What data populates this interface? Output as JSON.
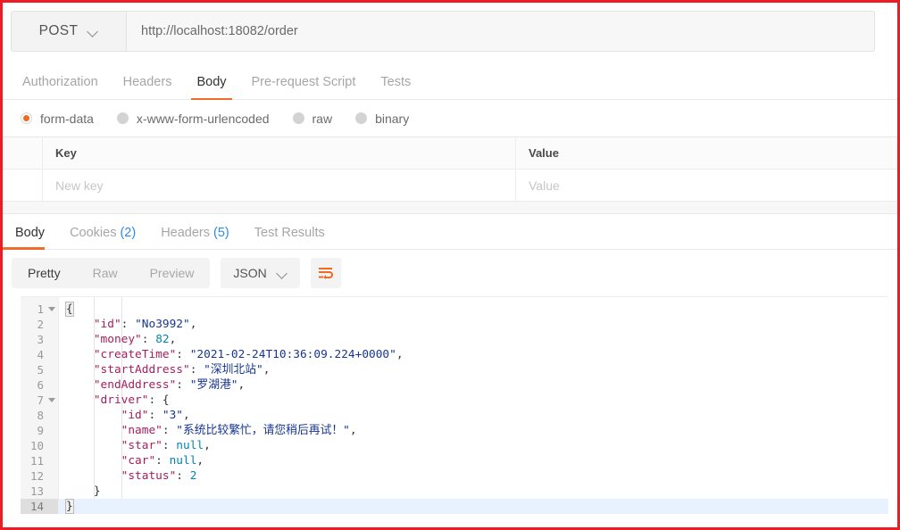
{
  "request": {
    "method": "POST",
    "method_icon": "chevron-down-icon",
    "url": "http://localhost:18082/order",
    "tabs": [
      {
        "label": "Authorization",
        "active": false
      },
      {
        "label": "Headers",
        "active": false
      },
      {
        "label": "Body",
        "active": true
      },
      {
        "label": "Pre-request Script",
        "active": false
      },
      {
        "label": "Tests",
        "active": false
      }
    ],
    "body_types": [
      {
        "label": "form-data",
        "selected": true
      },
      {
        "label": "x-www-form-urlencoded",
        "selected": false
      },
      {
        "label": "raw",
        "selected": false
      },
      {
        "label": "binary",
        "selected": false
      }
    ],
    "table": {
      "headers": [
        "Key",
        "Value"
      ],
      "rows": [
        {
          "key_placeholder": "New key",
          "value_placeholder": "Value"
        }
      ]
    }
  },
  "response": {
    "tabs": [
      {
        "label": "Body",
        "count": "",
        "active": true
      },
      {
        "label": "Cookies",
        "count": "(2)",
        "active": false
      },
      {
        "label": "Headers",
        "count": "(5)",
        "active": false
      },
      {
        "label": "Test Results",
        "count": "",
        "active": false
      }
    ],
    "view_modes": [
      {
        "label": "Pretty",
        "active": true
      },
      {
        "label": "Raw",
        "active": false
      },
      {
        "label": "Preview",
        "active": false
      }
    ],
    "format": "JSON",
    "format_icon": "chevron-down-icon",
    "wrap_icon": "word-wrap-icon",
    "body_json": {
      "id": "No3992",
      "money": 82,
      "createTime": "2021-02-24T10:36:09.224+0000",
      "startAddress": "深圳北站",
      "endAddress": "罗湖港",
      "driver": {
        "id": "3",
        "name": "系统比较繁忙，请您稍后再试！",
        "star": null,
        "car": null,
        "status": 2
      }
    },
    "code_lines": [
      {
        "num": "1",
        "fold": true,
        "indent": 0,
        "tokens": [
          {
            "t": "brk",
            "v": "{"
          }
        ]
      },
      {
        "num": "2",
        "fold": false,
        "indent": 1,
        "tokens": [
          {
            "t": "k",
            "v": "\"id\""
          },
          {
            "t": "p",
            "v": ": "
          },
          {
            "t": "s",
            "v": "\"No3992\""
          },
          {
            "t": "p",
            "v": ","
          }
        ]
      },
      {
        "num": "3",
        "fold": false,
        "indent": 1,
        "tokens": [
          {
            "t": "k",
            "v": "\"money\""
          },
          {
            "t": "p",
            "v": ": "
          },
          {
            "t": "n",
            "v": "82"
          },
          {
            "t": "p",
            "v": ","
          }
        ]
      },
      {
        "num": "4",
        "fold": false,
        "indent": 1,
        "tokens": [
          {
            "t": "k",
            "v": "\"createTime\""
          },
          {
            "t": "p",
            "v": ": "
          },
          {
            "t": "s",
            "v": "\"2021-02-24T10:36:09.224+0000\""
          },
          {
            "t": "p",
            "v": ","
          }
        ]
      },
      {
        "num": "5",
        "fold": false,
        "indent": 1,
        "tokens": [
          {
            "t": "k",
            "v": "\"startAddress\""
          },
          {
            "t": "p",
            "v": ": "
          },
          {
            "t": "s",
            "v": "\"深圳北站\""
          },
          {
            "t": "p",
            "v": ","
          }
        ]
      },
      {
        "num": "6",
        "fold": false,
        "indent": 1,
        "tokens": [
          {
            "t": "k",
            "v": "\"endAddress\""
          },
          {
            "t": "p",
            "v": ": "
          },
          {
            "t": "s",
            "v": "\"罗湖港\""
          },
          {
            "t": "p",
            "v": ","
          }
        ]
      },
      {
        "num": "7",
        "fold": true,
        "indent": 1,
        "tokens": [
          {
            "t": "k",
            "v": "\"driver\""
          },
          {
            "t": "p",
            "v": ": {"
          }
        ]
      },
      {
        "num": "8",
        "fold": false,
        "indent": 2,
        "tokens": [
          {
            "t": "k",
            "v": "\"id\""
          },
          {
            "t": "p",
            "v": ": "
          },
          {
            "t": "s",
            "v": "\"3\""
          },
          {
            "t": "p",
            "v": ","
          }
        ]
      },
      {
        "num": "9",
        "fold": false,
        "indent": 2,
        "tokens": [
          {
            "t": "k",
            "v": "\"name\""
          },
          {
            "t": "p",
            "v": ": "
          },
          {
            "t": "s",
            "v": "\"系统比较繁忙，请您稍后再试！\""
          },
          {
            "t": "p",
            "v": ","
          }
        ]
      },
      {
        "num": "10",
        "fold": false,
        "indent": 2,
        "tokens": [
          {
            "t": "k",
            "v": "\"star\""
          },
          {
            "t": "p",
            "v": ": "
          },
          {
            "t": "nul",
            "v": "null"
          },
          {
            "t": "p",
            "v": ","
          }
        ]
      },
      {
        "num": "11",
        "fold": false,
        "indent": 2,
        "tokens": [
          {
            "t": "k",
            "v": "\"car\""
          },
          {
            "t": "p",
            "v": ": "
          },
          {
            "t": "nul",
            "v": "null"
          },
          {
            "t": "p",
            "v": ","
          }
        ]
      },
      {
        "num": "12",
        "fold": false,
        "indent": 2,
        "tokens": [
          {
            "t": "k",
            "v": "\"status\""
          },
          {
            "t": "p",
            "v": ": "
          },
          {
            "t": "n",
            "v": "2"
          }
        ]
      },
      {
        "num": "13",
        "fold": false,
        "indent": 1,
        "tokens": [
          {
            "t": "p",
            "v": "}"
          }
        ]
      },
      {
        "num": "14",
        "fold": false,
        "indent": 0,
        "active": true,
        "caret": true,
        "tokens": [
          {
            "t": "brk",
            "v": "}"
          }
        ]
      }
    ]
  },
  "colors": {
    "accent": "#ef6c2e",
    "annotation_border": "#ed1c24",
    "link": "#2e8ae6",
    "json_key": "#a71d5d",
    "json_string": "#183691",
    "json_number": "#0086b3"
  }
}
